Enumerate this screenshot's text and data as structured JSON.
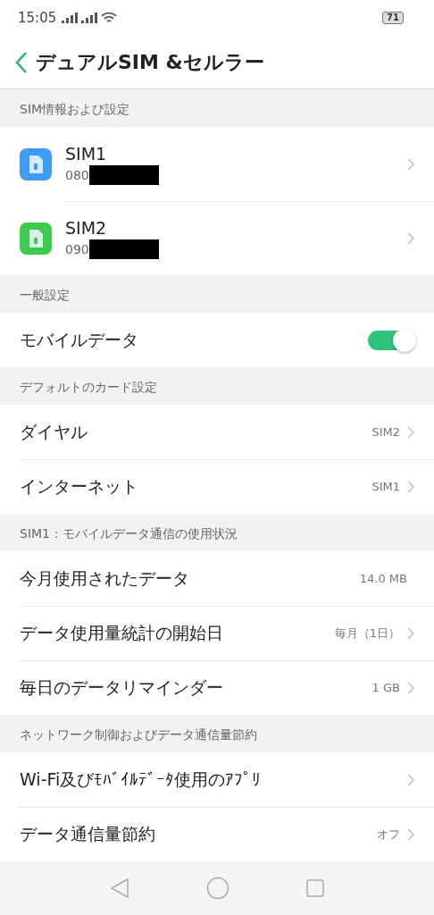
{
  "status_bar": {
    "time": "15:05",
    "battery": "71"
  },
  "header": {
    "title": "デュアルSIM &セルラー"
  },
  "sections": [
    {
      "title": "SIM情報および設定",
      "items": [
        {
          "kind": "sim",
          "label": "SIM1",
          "number": "080",
          "color": "#3d9af5"
        },
        {
          "kind": "sim",
          "label": "SIM2",
          "number": "090",
          "color": "#3ccb4a"
        }
      ]
    },
    {
      "title": "一般設定",
      "items": [
        {
          "kind": "toggle",
          "label": "モバイルデータ",
          "on": true
        }
      ]
    },
    {
      "title": "デフォルトのカード設定",
      "items": [
        {
          "kind": "link",
          "label": "ダイヤル",
          "value": "SIM2"
        },
        {
          "kind": "link",
          "label": "インターネット",
          "value": "SIM1"
        }
      ]
    },
    {
      "title": "SIM1：モバイルデータ通信の使用状況",
      "items": [
        {
          "kind": "info",
          "label": "今月使用されたデータ",
          "value": "14.0 MB"
        },
        {
          "kind": "link",
          "label": "データ使用量統計の開始日",
          "value": "毎月（1日）"
        },
        {
          "kind": "link",
          "label": "毎日のデータリマインダー",
          "value": "1 GB"
        }
      ]
    },
    {
      "title": "ネットワーク制御およびデータ通信量節約",
      "items": [
        {
          "kind": "link",
          "label": "Wi-Fi及びﾓﾊﾞｲﾙﾃﾞｰﾀ使用のｱﾌﾟﾘ"
        },
        {
          "kind": "link",
          "label": "データ通信量節約",
          "value": "オフ"
        }
      ]
    }
  ]
}
